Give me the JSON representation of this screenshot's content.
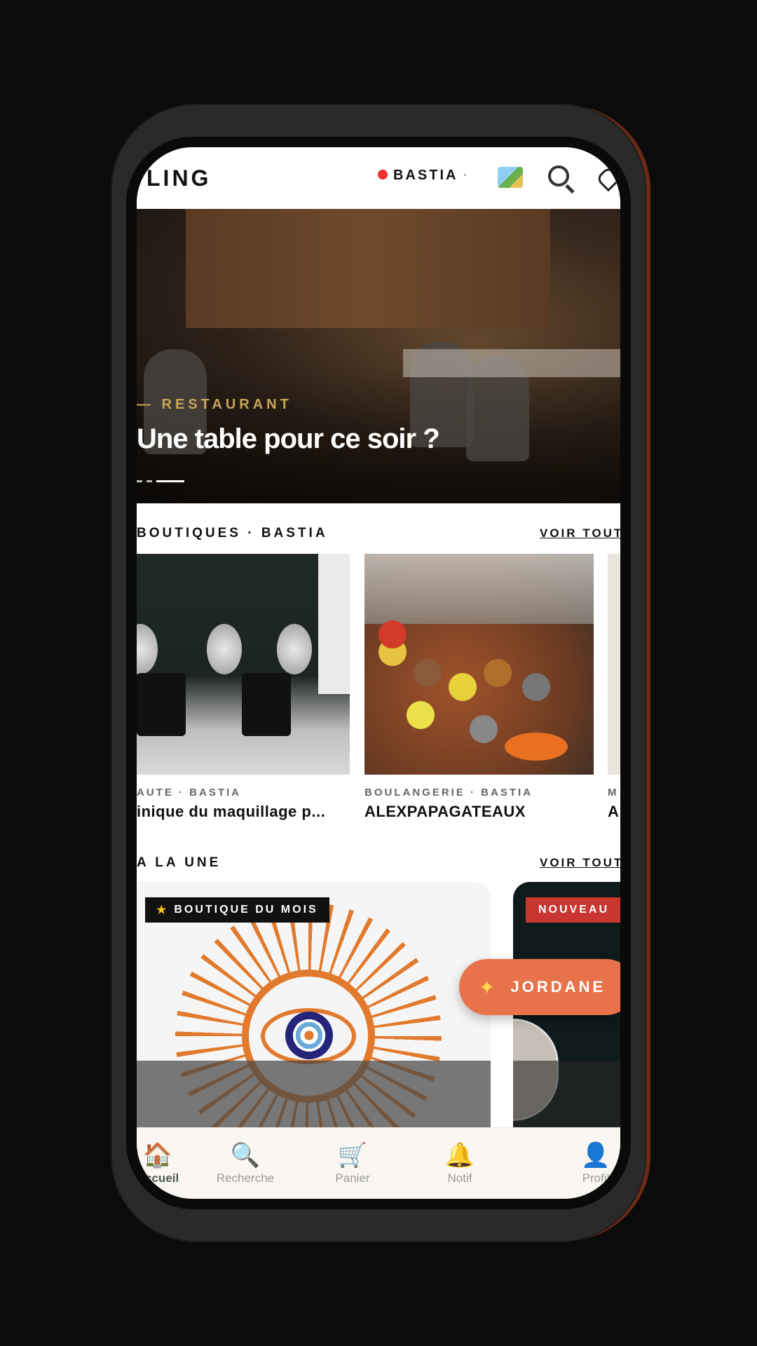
{
  "header": {
    "logo": "LING",
    "location": "BASTIA",
    "location_chevron": "•",
    "icons": [
      "map-icon",
      "search-icon",
      "heart-icon"
    ]
  },
  "hero": {
    "kicker": "— RESTAURANT",
    "title": "Une table pour ce soir ?"
  },
  "shops_section": {
    "title": "BOUTIQUES · BASTIA",
    "link": "VOIR TOUT",
    "cards": [
      {
        "category": "AUTE · BASTIA",
        "name": "inique du maquillage p..."
      },
      {
        "category": "BOULANGERIE · BASTIA",
        "name": "ALEXPAPAGATEAUX"
      },
      {
        "category": "M",
        "name": "A"
      }
    ]
  },
  "featured_section": {
    "title": "A LA UNE",
    "link": "VOIR TOUT",
    "badge_shop_of_month": "BOUTIQUE DU MOIS",
    "badge_shop_icon": "star-icon",
    "badge_new": "NOUVEAU"
  },
  "fab": {
    "label": "JORDANE",
    "icon": "sparkles-icon"
  },
  "nav": {
    "items": [
      {
        "label": "Accueil",
        "icon": "house-icon",
        "active": true
      },
      {
        "label": "Recherche",
        "icon": "search-icon",
        "active": false
      },
      {
        "label": "Panier",
        "icon": "cart-icon",
        "active": false
      },
      {
        "label": "Notif",
        "icon": "bell-icon",
        "active": false
      },
      {
        "label": "Profil",
        "icon": "user-icon",
        "active": false
      }
    ]
  },
  "colors": {
    "accent_gold": "#c9a45a",
    "fab_orange": "#e8734a",
    "badge_red": "#c9362f",
    "brand_orange": "#e17a2d"
  }
}
